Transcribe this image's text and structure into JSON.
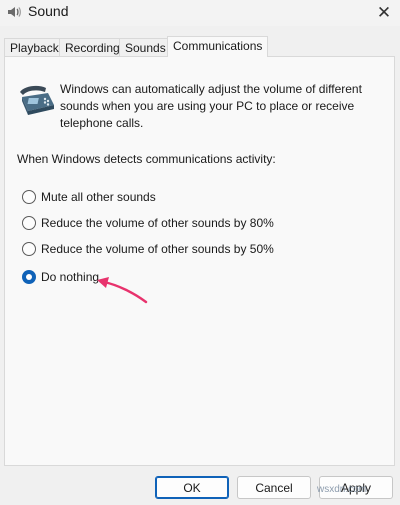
{
  "window": {
    "title": "Sound",
    "close_glyph": "✕"
  },
  "tabs": [
    {
      "label": "Playback",
      "active": false
    },
    {
      "label": "Recording",
      "active": false
    },
    {
      "label": "Sounds",
      "active": false
    },
    {
      "label": "Communications",
      "active": true
    }
  ],
  "communications": {
    "description": "Windows can automatically adjust the volume of different sounds when you are using your PC to place or receive telephone calls.",
    "detect_label": "When Windows detects communications activity:",
    "options": [
      {
        "label": "Mute all other sounds",
        "checked": false
      },
      {
        "label": "Reduce the volume of other sounds by 80%",
        "checked": false
      },
      {
        "label": "Reduce the volume of other sounds by 50%",
        "checked": false
      },
      {
        "label": "Do nothing",
        "checked": true
      }
    ]
  },
  "buttons": {
    "ok": "OK",
    "cancel": "Cancel",
    "apply": "Apply"
  },
  "watermark": "wsxdn.com",
  "colors": {
    "accent": "#0f62b8",
    "annotation_arrow": "#e8336d"
  }
}
